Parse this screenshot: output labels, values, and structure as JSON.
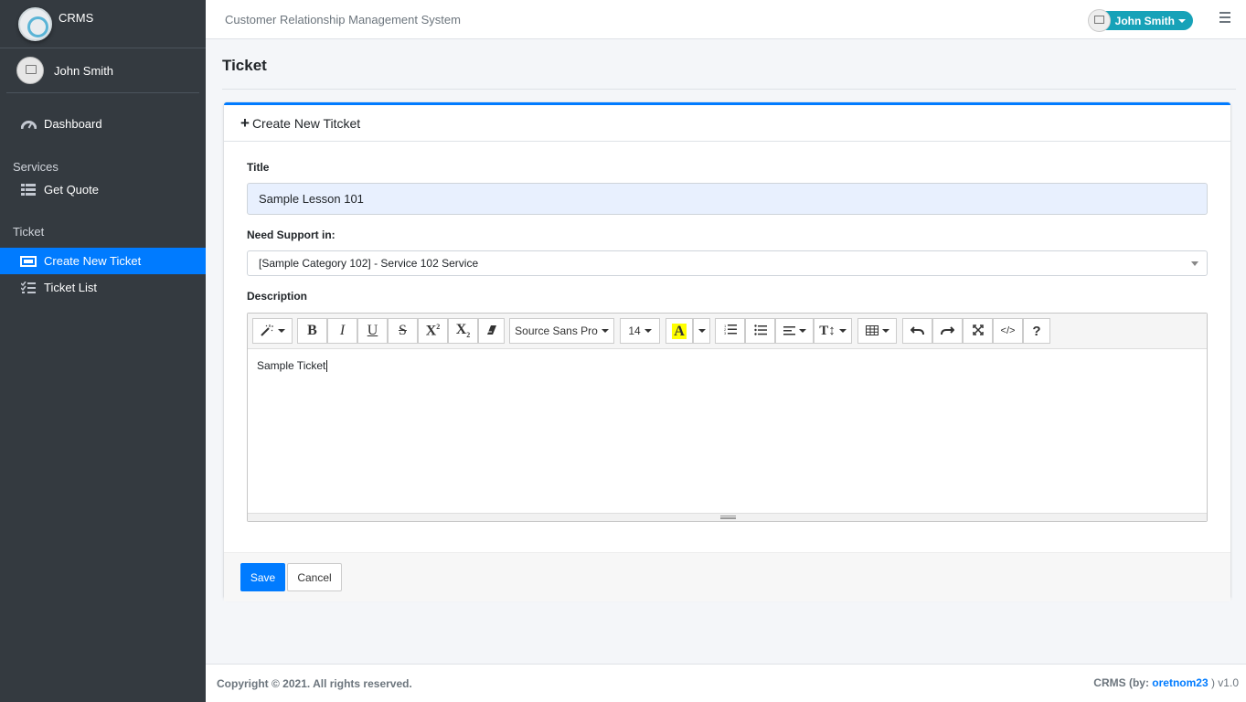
{
  "app": {
    "brand": "CRMS",
    "system_title": "Customer Relationship Management System"
  },
  "user": {
    "name": "John Smith"
  },
  "sidebar": {
    "items": [
      {
        "label": "Dashboard",
        "icon": "tachometer-icon"
      },
      {
        "header": "Services"
      },
      {
        "label": "Get Quote",
        "icon": "table-list-icon"
      },
      {
        "header": "Ticket"
      },
      {
        "label": "Create New Ticket",
        "icon": "ticket-icon",
        "active": true
      },
      {
        "label": "Ticket List",
        "icon": "tasks-list-icon"
      }
    ]
  },
  "page": {
    "title": "Ticket"
  },
  "card": {
    "header": "Create New Titcket",
    "title_label": "Title",
    "title_value": "Sample Lesson 101",
    "support_label": "Need Support in:",
    "support_value": "[Sample Category 102] - Service 102 Service",
    "description_label": "Description",
    "description_value": "Sample Ticket"
  },
  "editor_toolbar": {
    "font_name": "Source Sans Pro",
    "font_size": "14",
    "buttons": [
      "magic-icon",
      "bold-icon",
      "italic-icon",
      "underline-icon",
      "strikethrough-icon",
      "superscript-icon",
      "subscript-icon",
      "eraser-icon",
      "font-name-dropdown",
      "font-size-dropdown",
      "color-icon",
      "color-dropdown",
      "ordered-list-icon",
      "unordered-list-icon",
      "align-icon",
      "line-height-icon",
      "table-icon",
      "undo-icon",
      "redo-icon",
      "fullscreen-icon",
      "code-view-icon",
      "help-icon"
    ]
  },
  "actions": {
    "save": "Save",
    "cancel": "Cancel"
  },
  "footer": {
    "copyright": "Copyright © 2021. All rights reserved.",
    "brand_prefix": "CRMS (by: ",
    "author": "oretnom23",
    "version": " ) v1.0"
  },
  "colors": {
    "sidebar": "#343a40",
    "primary": "#007bff",
    "user_pill": "#17a2b8"
  }
}
